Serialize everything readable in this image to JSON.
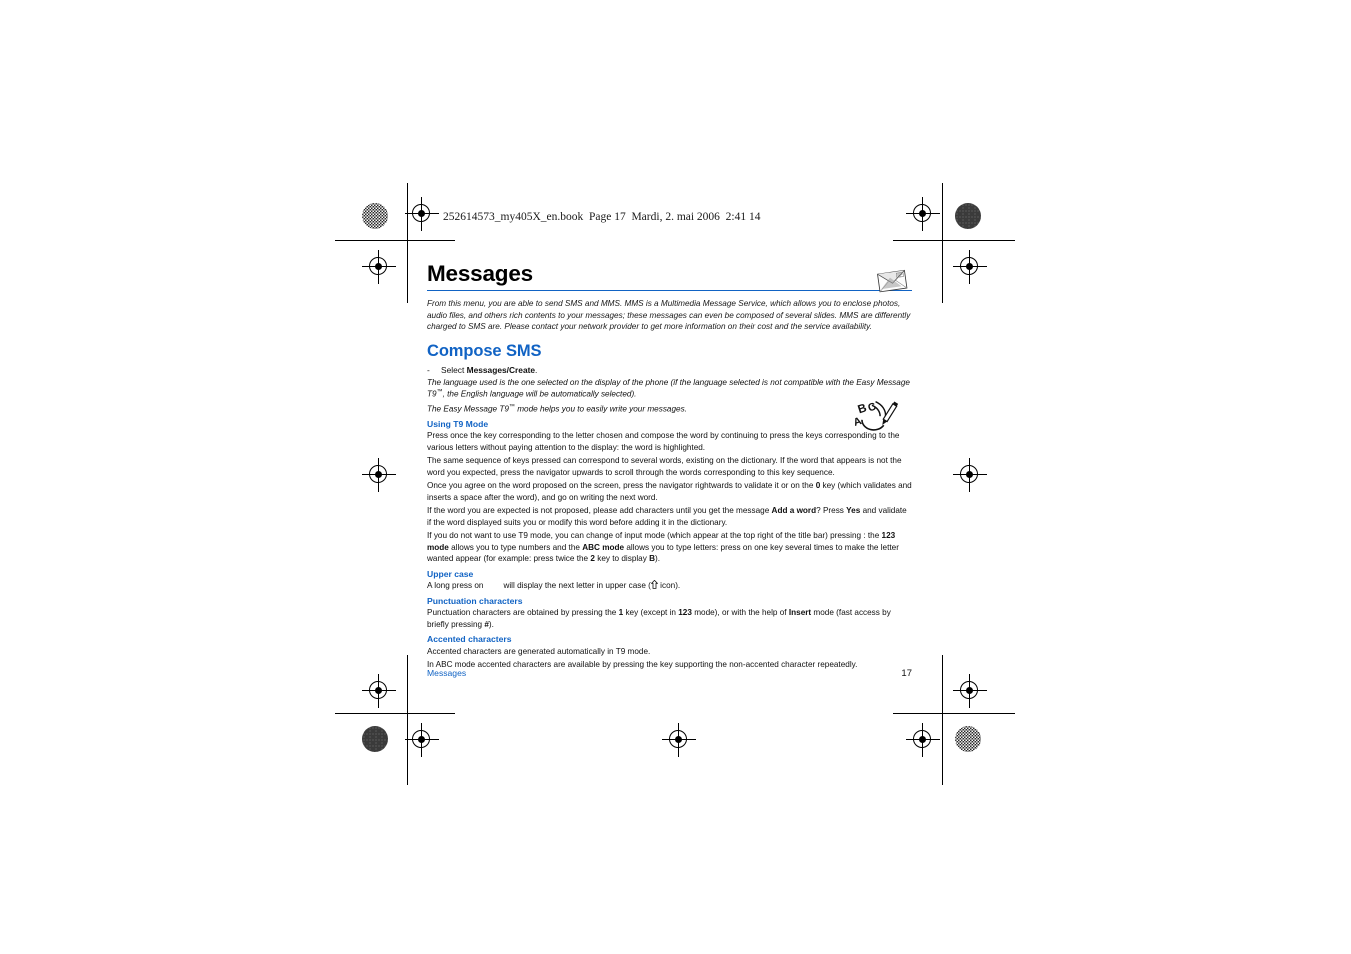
{
  "book_header": "252614573_my405X_en.book  Page 17  Mardi, 2. mai 2006  2:41 14",
  "colors": {
    "heading_blue": "#1163c4",
    "rule_blue": "#1163c4",
    "body_black": "#111111"
  },
  "page": {
    "title": "Messages",
    "intro": "From this menu, you are able to send SMS and MMS. MMS is a Multimedia Message Service, which allows you to enclose photos, audio files, and others rich contents to your messages; these messages can even be composed of several slides. MMS are differently charged to SMS are. Please contact your network provider to get more information on their cost and the service availability.",
    "section_title": "Compose SMS",
    "bullet": {
      "dash": "-",
      "pre": "Select ",
      "bold": "Messages/Create",
      "post": "."
    },
    "lang_note_1_a": "The language used is the one selected on the display of the phone (if the language selected is not compatible with the Easy Message T9",
    "lang_note_1_b": ", the English language will be automatically selected).",
    "lang_note_2_a": "The Easy Message T9",
    "lang_note_2_b": " mode helps you to easily write your messages.",
    "subsections": [
      {
        "heading": "Using T9 Mode",
        "paragraphs": [
          "Press once the key corresponding to the letter chosen and compose the word by continuing to press the keys corresponding to the various letters without paying attention to the display: the word is highlighted.",
          "The same sequence of keys pressed can correspond to several words, existing on the dictionary. If the word that appears is not the word you expected, press the navigator upwards to scroll through the words corresponding to this key sequence."
        ]
      }
    ],
    "para_validate_a": "Once you agree on the word proposed on the screen, press the navigator rightwards to validate it or on the ",
    "para_validate_bold": "0",
    "para_validate_b": " key (which validates and inserts a space after the word), and go on writing the next word.",
    "para_addword_a": "If the word you are expected is not proposed, please add characters until you get the message ",
    "para_addword_bold1": "Add a word",
    "para_addword_b": "? Press ",
    "para_addword_bold2": "Yes",
    "para_addword_c": " and validate if the word displayed suits you or modify this word before adding it in the dictionary.",
    "para_mode_a": "If you do not want to use T9 mode, you can change of input mode (which appear at the top right of the title bar) pressing  : the ",
    "para_mode_bold1": "123 mode",
    "para_mode_b": " allows you to type numbers and the ",
    "para_mode_bold2": "ABC mode",
    "para_mode_c": " allows you to type letters: press on one key several times to make the letter wanted appear (for example: press twice the ",
    "para_mode_bold3": "2",
    "para_mode_d": " key to display ",
    "para_mode_bold4": "B",
    "para_mode_e": ").",
    "upper_case": {
      "heading": "Upper case",
      "text_a": "A long press on",
      "text_b": "will display the next letter in upper case (",
      "icon": "up-arrow-shift-icon",
      "text_c": " icon)."
    },
    "punctuation": {
      "heading": "Punctuation characters",
      "text_a": "Punctuation characters are obtained by pressing the ",
      "bold1": "1",
      "text_b": " key (except in ",
      "bold2": "123",
      "text_c": " mode), or with the help of ",
      "bold3": "Insert",
      "text_d": " mode (fast access by briefly pressing ",
      "bold4": "#",
      "text_e": ")."
    },
    "accented": {
      "heading": "Accented characters",
      "line1": "Accented characters are generated automatically in T9 mode.",
      "line2": "In ABC mode accented characters are available by pressing the key supporting the non-accented character repeatedly."
    },
    "footer_left": "Messages",
    "footer_right": "17"
  },
  "icons": {
    "mail": "mail-envelope-icon",
    "t9": "t9-abc-pencil-icon"
  }
}
